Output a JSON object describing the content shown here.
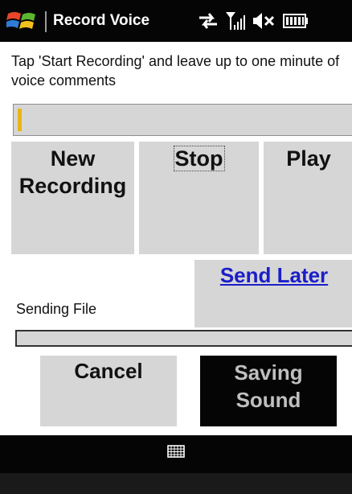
{
  "app": {
    "title": "Record Voice"
  },
  "status_icons": [
    "sync-arrows-icon",
    "signal-strength-icon",
    "speaker-muted-icon",
    "battery-icon"
  ],
  "instruction": "Tap 'Start Recording' and leave up to one minute of voice comments",
  "text_field": {
    "value": ""
  },
  "buttons": {
    "new_recording": "New Recording",
    "stop": "Stop",
    "play": "Play",
    "send_later": "Send Later",
    "cancel": "Cancel",
    "saving_sound": "Saving Sound"
  },
  "sending": {
    "label": "Sending File",
    "progress": 0
  },
  "bottom_bar": {
    "icon": "keyboard-icon"
  },
  "colors": {
    "bar": "#050505",
    "button": "#d6d6d6",
    "link": "#1b1ec8",
    "caret": "#e8b513"
  }
}
